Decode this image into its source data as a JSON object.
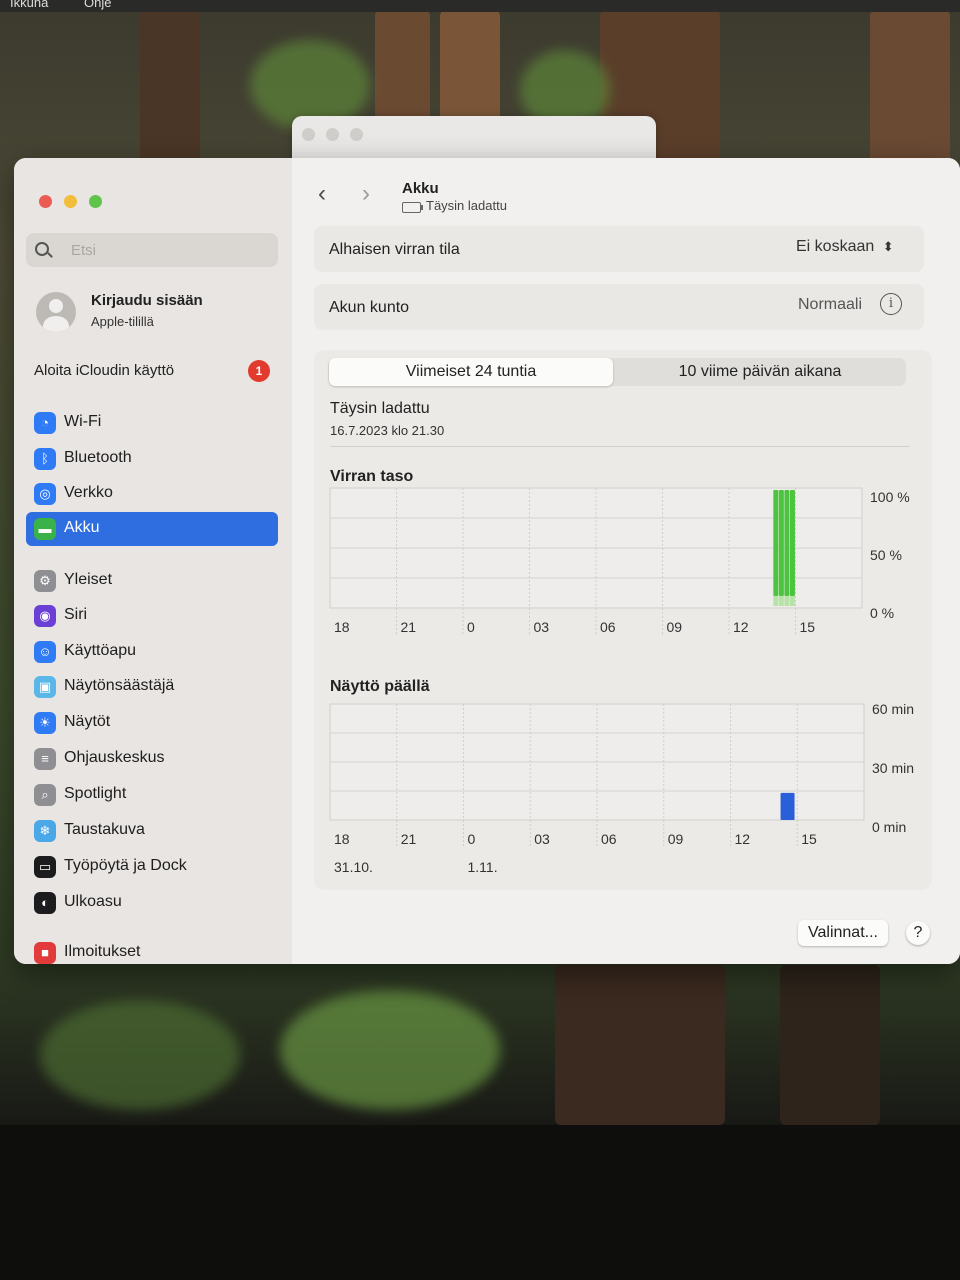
{
  "menubar": {
    "items": [
      "Ikkuna",
      "Ohje"
    ]
  },
  "sidebar": {
    "search_placeholder": "Etsi",
    "account": {
      "title": "Kirjaudu sisään",
      "subtitle": "Apple-tilillä"
    },
    "icloud": {
      "label": "Aloita iCloudin käyttö",
      "badge": "1"
    },
    "items": [
      {
        "label": "Wi-Fi",
        "icon": "wifi-icon",
        "color": "#2f7bf5"
      },
      {
        "label": "Bluetooth",
        "icon": "bluetooth-icon",
        "color": "#2f7bf5"
      },
      {
        "label": "Verkko",
        "icon": "globe-icon",
        "color": "#2f7bf5"
      },
      {
        "label": "Akku",
        "icon": "battery-icon",
        "color": "#39b24a",
        "active": true
      },
      {
        "label": "Yleiset",
        "icon": "gear-icon",
        "color": "#8e8e93"
      },
      {
        "label": "Siri",
        "icon": "siri-icon",
        "color": "#6b3fd6"
      },
      {
        "label": "Käyttöapu",
        "icon": "accessibility-icon",
        "color": "#2f7bf5"
      },
      {
        "label": "Näytönsäästäjä",
        "icon": "screensaver-icon",
        "color": "#5ab7e8"
      },
      {
        "label": "Näytöt",
        "icon": "brightness-icon",
        "color": "#2f7bf5"
      },
      {
        "label": "Ohjauskeskus",
        "icon": "control-center-icon",
        "color": "#8e8e93"
      },
      {
        "label": "Spotlight",
        "icon": "spotlight-icon",
        "color": "#8e8e93"
      },
      {
        "label": "Taustakuva",
        "icon": "wallpaper-icon",
        "color": "#4aa8e8"
      },
      {
        "label": "Työpöytä ja Dock",
        "icon": "dock-icon",
        "color": "#1c1c1e"
      },
      {
        "label": "Ulkoasu",
        "icon": "appearance-icon",
        "color": "#1c1c1e"
      },
      {
        "label": "Ilmoitukset",
        "icon": "notifications-icon",
        "color": "#e23b3b"
      }
    ]
  },
  "header": {
    "title": "Akku",
    "subtitle": "Täysin ladattu"
  },
  "low_power": {
    "label": "Alhaisen virran tila",
    "value": "Ei koskaan"
  },
  "health": {
    "label": "Akun kunto",
    "value": "Normaali"
  },
  "tabs": [
    {
      "label": "Viimeiset 24 tuntia",
      "selected": true
    },
    {
      "label": "10 viime päivän aikana",
      "selected": false
    }
  ],
  "charged": {
    "title": "Täysin ladattu",
    "date": "16.7.2023 klo 21.30"
  },
  "chart_data": [
    {
      "type": "bar",
      "title": "Virran taso",
      "x_ticks": [
        "18",
        "21",
        "0",
        "03",
        "06",
        "09",
        "12",
        "15"
      ],
      "y_ticks": [
        "100 %",
        "50 %",
        "0 %"
      ],
      "ylim": [
        0,
        100
      ],
      "series": [
        {
          "color": "#4cc43f",
          "points": [
            {
              "x_hours_from_start": 20.0,
              "y": 100
            },
            {
              "x_hours_from_start": 20.25,
              "y": 100
            },
            {
              "x_hours_from_start": 20.5,
              "y": 100
            },
            {
              "x_hours_from_start": 20.75,
              "y": 100
            }
          ]
        }
      ]
    },
    {
      "type": "bar",
      "title": "Näyttö päällä",
      "x_ticks": [
        "18",
        "21",
        "0",
        "03",
        "06",
        "09",
        "12",
        "15"
      ],
      "x_dates": [
        "31.10.",
        "1.11."
      ],
      "y_ticks": [
        "60 min",
        "30 min",
        "0 min"
      ],
      "ylim": [
        0,
        60
      ],
      "series": [
        {
          "color": "#2b5fd9",
          "points": [
            {
              "x_hours_from_start": 20.25,
              "y": 14
            }
          ]
        }
      ]
    }
  ],
  "footer": {
    "options_label": "Valinnat...",
    "help_label": "?"
  }
}
